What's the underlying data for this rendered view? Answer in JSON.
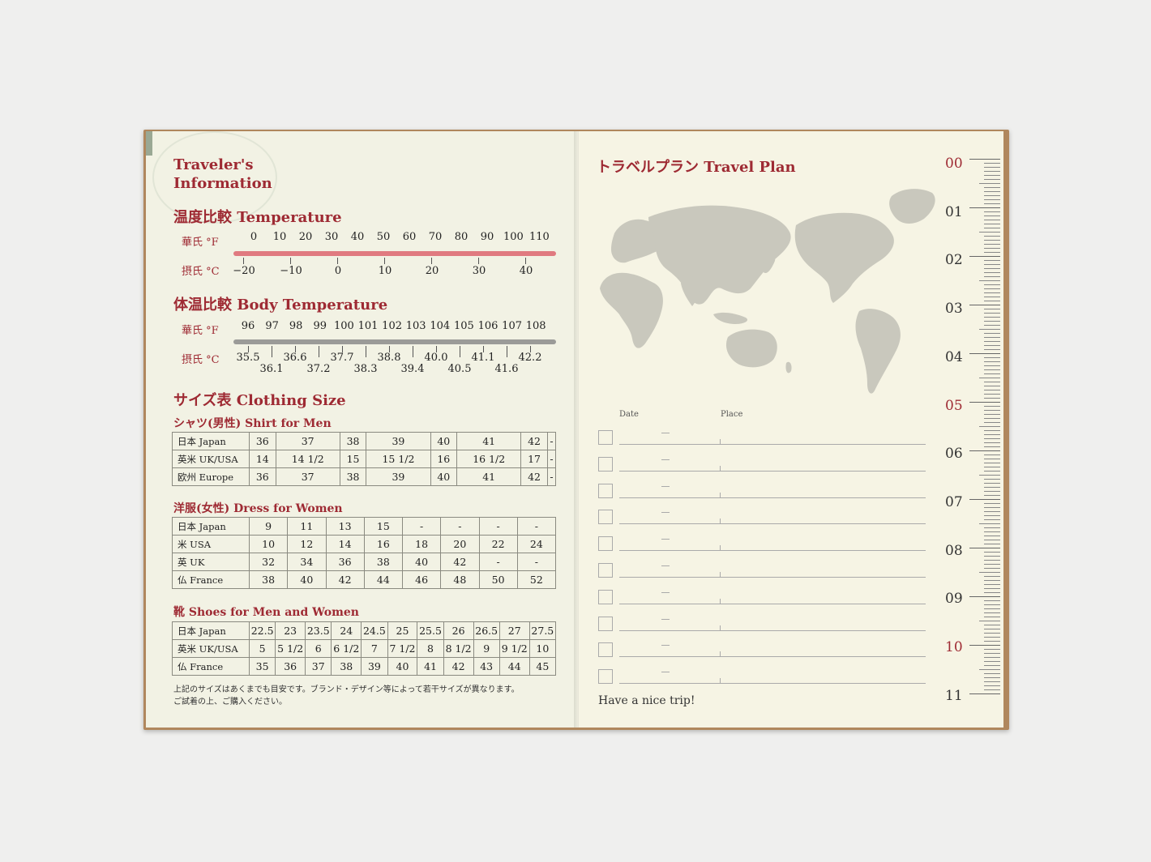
{
  "left": {
    "title_line1": "Traveler's",
    "title_line2": "Information",
    "temperature": {
      "heading": "温度比較  Temperature",
      "f_label": "華氏 °F",
      "c_label": "摂氏 °C",
      "f_values": [
        "0",
        "10",
        "20",
        "30",
        "40",
        "50",
        "60",
        "70",
        "80",
        "90",
        "100",
        "110"
      ],
      "c_values": [
        "−20",
        "−10",
        "0",
        "10",
        "20",
        "30",
        "40"
      ],
      "bar_color": "#e07a80"
    },
    "body_temperature": {
      "heading": "体温比較  Body Temperature",
      "f_label": "華氏 °F",
      "c_label": "摂氏 °C",
      "f_values": [
        "96",
        "97",
        "98",
        "99",
        "100",
        "101",
        "102",
        "103",
        "104",
        "105",
        "106",
        "107",
        "108"
      ],
      "c_values_upper": [
        "35.5",
        "36.6",
        "37.7",
        "38.8",
        "40.0",
        "41.1",
        "42.2"
      ],
      "c_values_lower": [
        "36.1",
        "37.2",
        "38.3",
        "39.4",
        "40.5",
        "41.6"
      ],
      "bar_color": "#9b9b98"
    },
    "clothing": {
      "heading": "サイズ表  Clothing Size",
      "shirt": {
        "heading": "シャツ(男性)  Shirt for Men",
        "rows": [
          {
            "label": "日本  Japan",
            "values": [
              "36",
              "37",
              "38",
              "39",
              "40",
              "41",
              "42",
              "-"
            ]
          },
          {
            "label": "英米  UK/USA",
            "values": [
              "14",
              "14 1/2",
              "15",
              "15 1/2",
              "16",
              "16 1/2",
              "17",
              "-"
            ]
          },
          {
            "label": "欧州  Europe",
            "values": [
              "36",
              "37",
              "38",
              "39",
              "40",
              "41",
              "42",
              "-"
            ]
          }
        ]
      },
      "dress": {
        "heading": "洋服(女性)  Dress for Women",
        "rows": [
          {
            "label": "日本  Japan",
            "values": [
              "9",
              "11",
              "13",
              "15",
              "-",
              "-",
              "-",
              "-"
            ]
          },
          {
            "label": "米    USA",
            "values": [
              "10",
              "12",
              "14",
              "16",
              "18",
              "20",
              "22",
              "24"
            ]
          },
          {
            "label": "英    UK",
            "values": [
              "32",
              "34",
              "36",
              "38",
              "40",
              "42",
              "-",
              "-"
            ]
          },
          {
            "label": "仏    France",
            "values": [
              "38",
              "40",
              "42",
              "44",
              "46",
              "48",
              "50",
              "52"
            ]
          }
        ]
      },
      "shoes": {
        "heading": "靴  Shoes for Men and Women",
        "rows": [
          {
            "label": "日本  Japan",
            "values": [
              "22.5",
              "23",
              "23.5",
              "24",
              "24.5",
              "25",
              "25.5",
              "26",
              "26.5",
              "27",
              "27.5"
            ]
          },
          {
            "label": "英米  UK/USA",
            "values": [
              "5",
              "5 1/2",
              "6",
              "6 1/2",
              "7",
              "7 1/2",
              "8",
              "8 1/2",
              "9",
              "9 1/2",
              "10"
            ]
          },
          {
            "label": "仏    France",
            "values": [
              "35",
              "36",
              "37",
              "38",
              "39",
              "40",
              "41",
              "42",
              "43",
              "44",
              "45"
            ]
          }
        ]
      },
      "note_line1": "上記のサイズはあくまでも目安です。ブランド・デザイン等によって若干サイズが異なります。",
      "note_line2": "ご試着の上、ご購入ください。"
    }
  },
  "right": {
    "title": "トラベルプラン  Travel Plan",
    "date_label": "Date",
    "place_label": "Place",
    "footer": "Have a nice trip!",
    "hours": [
      "00",
      "01",
      "02",
      "03",
      "04",
      "05",
      "06",
      "07",
      "08",
      "09",
      "10",
      "11"
    ],
    "red_hours": [
      "00",
      "05",
      "10"
    ],
    "map_color": "#c9c8bd"
  }
}
